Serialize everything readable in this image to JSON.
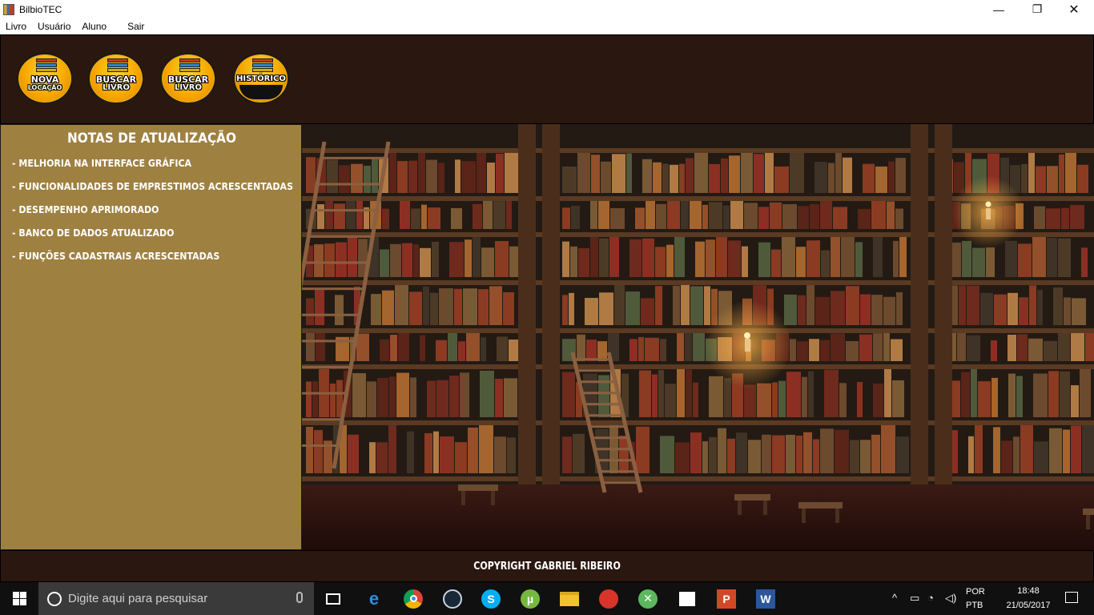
{
  "window": {
    "title": "BilbioTEC",
    "min": "—",
    "max": "❐",
    "close": "✕"
  },
  "menu": {
    "items": [
      "Livro",
      "Usuário",
      "Aluno",
      "Sair"
    ]
  },
  "toolbar": {
    "buttons": [
      {
        "line1": "NOVA",
        "line2": "LOCAÇÃO"
      },
      {
        "line1": "BUSCAR",
        "line2": "LIVRO"
      },
      {
        "line1": "BUSCAR",
        "line2": "LIVRO"
      },
      {
        "line1": "HISTÓRICO",
        "line2": ""
      }
    ]
  },
  "notes": {
    "title": "NOTAS DE ATUALIZAÇÃO",
    "items": [
      "- MELHORIA NA INTERFACE GRÁFICA",
      "- FUNCIONALIDADES DE EMPRESTIMOS ACRESCENTADAS",
      "- DESEMPENHO APRIMORADO",
      "- BANCO DE DADOS ATUALIZADO",
      "- FUNÇÕES CADASTRAIS ACRESCENTADAS"
    ]
  },
  "footer": {
    "text": "COPYRIGHT GABRIEL RIBEIRO"
  },
  "taskbar": {
    "search_placeholder": "Digite aqui para pesquisar",
    "apps": [
      "task-view",
      "edge",
      "chrome",
      "steam",
      "skype",
      "utorrent",
      "file-explorer",
      "app-red",
      "xbox",
      "store",
      "powerpoint",
      "word"
    ],
    "lang1": "POR",
    "lang2": "PTB",
    "time": "18:48",
    "date": "21/05/2017"
  },
  "colors": {
    "toolbar_bg": "#2a170f",
    "notes_bg": "#9e8040",
    "button_gold": "#f7a800"
  }
}
